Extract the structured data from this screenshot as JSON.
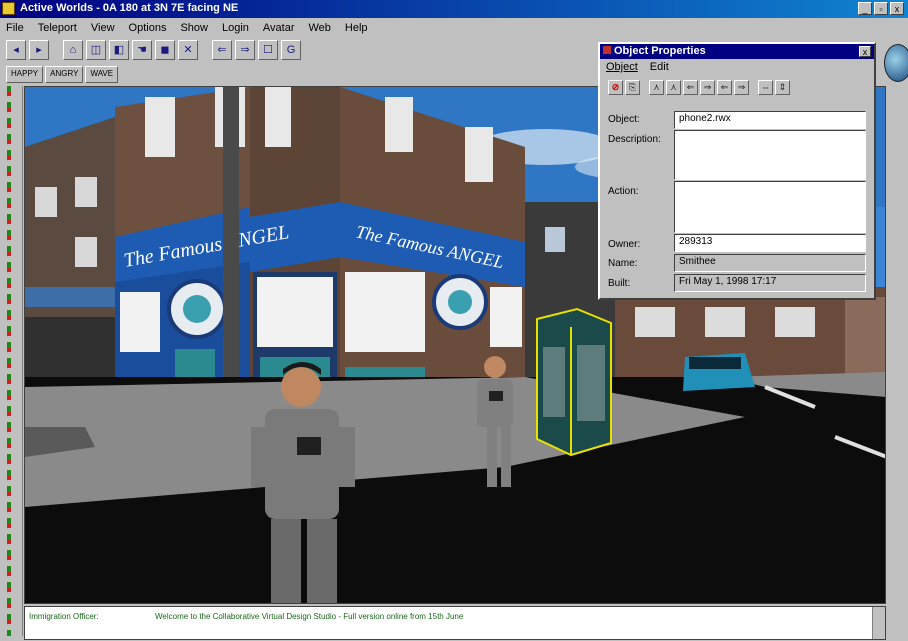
{
  "window": {
    "title": "Active Worlds - 0A 180 at 3N 7E facing NE",
    "controls": [
      "_",
      "▫",
      "x"
    ]
  },
  "menu": [
    "File",
    "Teleport",
    "View",
    "Options",
    "Show",
    "Login",
    "Avatar",
    "Web",
    "Help"
  ],
  "toolbar": {
    "buttons": [
      "◂",
      "▸",
      "⌂",
      "◫",
      "◧",
      "☚",
      "◼",
      "✕",
      "⇐",
      "⇒",
      "☐",
      "G"
    ]
  },
  "gestures": [
    "HAPPY",
    "ANGRY",
    "WAVE"
  ],
  "scene": {
    "sign_text_front": "The Famous ANGEL",
    "sign_text_side": "The Famous ANGEL",
    "colors": {
      "sky": "#2e78c8",
      "pub_blue": "#1e5cb4",
      "brick": "#6a4a3a",
      "ground": "#0c0c0c",
      "pavement": "#8a8a8a",
      "car": "#2090b8",
      "selection": "#e8e000"
    }
  },
  "chat": {
    "speaker": "Immigration Officer:",
    "message": "Welcome to the Collaborative Virtual Design Studio - Full version online from 15th June"
  },
  "dialog": {
    "title": "Object Properties",
    "menu": [
      "Object",
      "Edit"
    ],
    "close": "x",
    "tools": [
      "⊘",
      "⎘",
      "⋏",
      "⋏",
      "⇐",
      "⇒",
      "⇐",
      "⇒",
      "⇔",
      "⇕"
    ],
    "fields": {
      "object_label": "Object:",
      "object_value": "phone2.rwx",
      "description_label": "Description:",
      "description_value": "",
      "action_label": "Action:",
      "action_value": "",
      "owner_label": "Owner:",
      "owner_value": "289313",
      "name_label": "Name:",
      "name_value": "Smithee",
      "built_label": "Built:",
      "built_value": "Fri May 1, 1998 17:17"
    }
  }
}
